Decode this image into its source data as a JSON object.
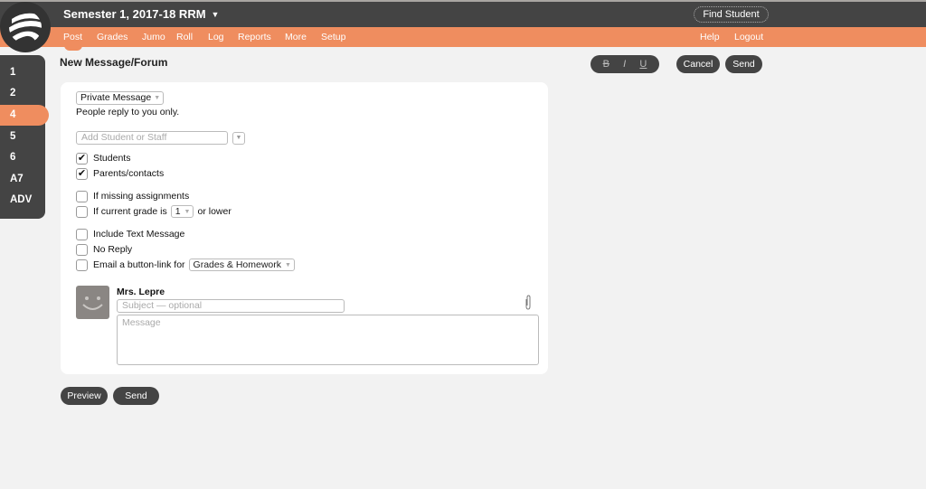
{
  "header": {
    "semester": "Semester 1, 2017-18 RRM",
    "find_student": "Find Student"
  },
  "nav": {
    "items": [
      "Post",
      "Grades",
      "Jumo",
      "Roll",
      "Log",
      "Reports",
      "More",
      "Setup"
    ],
    "active": "Post",
    "right_items": [
      "Help",
      "Logout"
    ]
  },
  "sidebar": {
    "periods": [
      "1",
      "2",
      "4",
      "5",
      "6",
      "A7",
      "ADV"
    ],
    "active": "4"
  },
  "page": {
    "title": "New Message/Forum"
  },
  "toolbar": {
    "bold": "B",
    "italic": "I",
    "underline": "U",
    "cancel": "Cancel",
    "send": "Send"
  },
  "form": {
    "message_type": "Private Message",
    "message_type_hint": "People reply to you only.",
    "recipient_placeholder": "Add Student or Staff",
    "students_label": "Students",
    "students_checked": true,
    "parents_label": "Parents/contacts",
    "parents_checked": true,
    "missing_label": "If missing assignments",
    "missing_checked": false,
    "grade_prefix": "If current grade is",
    "grade_value": "1",
    "grade_suffix": "or lower",
    "grade_checked": false,
    "text_message_label": "Include Text Message",
    "text_message_checked": false,
    "no_reply_label": "No Reply",
    "no_reply_checked": false,
    "email_link_label": "Email a button-link for",
    "email_link_value": "Grades & Homework",
    "email_link_checked": false
  },
  "compose": {
    "author": "Mrs. Lepre",
    "subject_placeholder": "Subject — optional",
    "message_placeholder": "Message"
  },
  "footer": {
    "preview": "Preview",
    "send": "Send"
  },
  "colors": {
    "accent": "#ef8d5f",
    "dark": "#444444"
  },
  "check_glyph": "✔",
  "caret_glyph": "▼"
}
